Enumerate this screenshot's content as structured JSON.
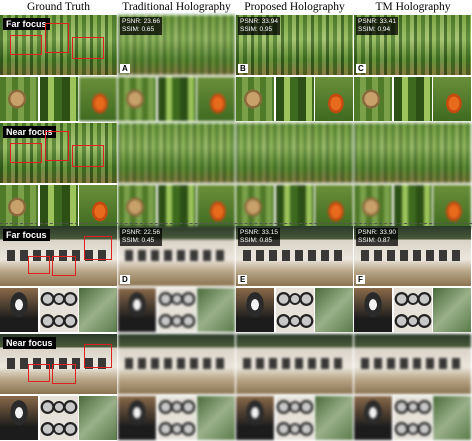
{
  "columns": [
    {
      "title": "Ground Truth"
    },
    {
      "title": "Traditional Holography"
    },
    {
      "title": "Proposed Holography"
    },
    {
      "title": "TM Holography"
    }
  ],
  "scenes": [
    {
      "name": "bamboo",
      "far_label": "Far focus",
      "near_label": "Near focus",
      "metrics": [
        null,
        {
          "psnr": "PSNR: 23.66",
          "ssim": "SSIM: 0.65",
          "letter": "A"
        },
        {
          "psnr": "PSNR: 33.94",
          "ssim": "SSIM: 0.95",
          "letter": "B"
        },
        {
          "psnr": "PSNR: 33.41",
          "ssim": "SSIM: 0.94",
          "letter": "C"
        }
      ]
    },
    {
      "name": "room",
      "far_label": "Far focus",
      "near_label": "Near focus",
      "metrics": [
        null,
        {
          "psnr": "PSNR: 22.56",
          "ssim": "SSIM: 0.45",
          "letter": "D"
        },
        {
          "psnr": "PSNR: 33.15",
          "ssim": "SSIM: 0.85",
          "letter": "E"
        },
        {
          "psnr": "PSNR: 33.90",
          "ssim": "SSIM: 0.87",
          "letter": "F"
        }
      ]
    }
  ],
  "colors": {
    "highlight_box": "#e02020",
    "label_bg": "#000000"
  }
}
